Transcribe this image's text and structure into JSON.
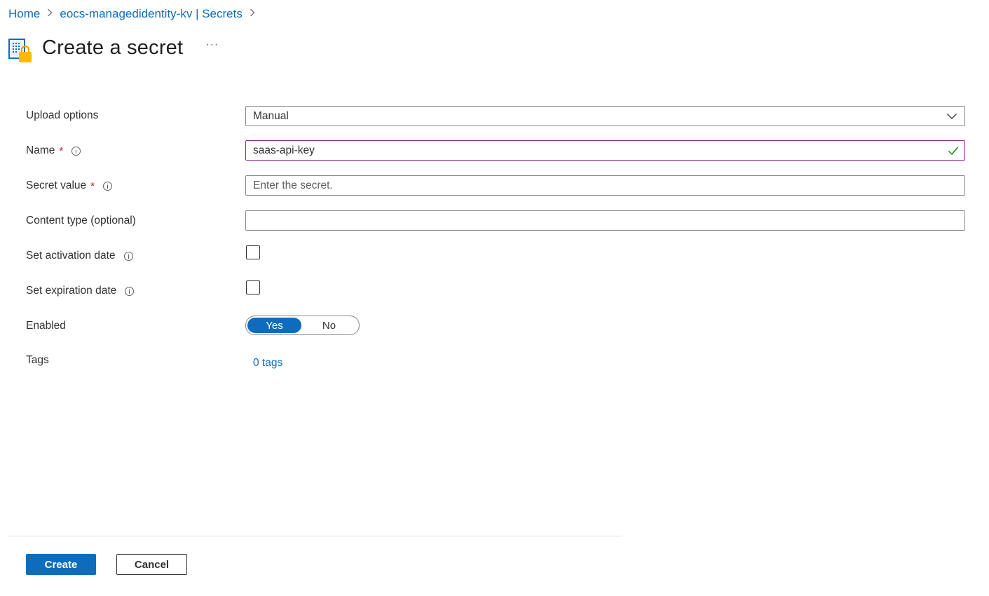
{
  "breadcrumb": {
    "home": "Home",
    "parent": "eocs-managedidentity-kv | Secrets"
  },
  "page": {
    "title": "Create a secret",
    "more": "···"
  },
  "form": {
    "upload_options": {
      "label": "Upload options",
      "value": "Manual"
    },
    "name": {
      "label": "Name",
      "required_mark": "*",
      "value": "saas-api-key"
    },
    "secret_value": {
      "label": "Secret value",
      "required_mark": "*",
      "placeholder": "Enter the secret."
    },
    "content_type": {
      "label": "Content type (optional)",
      "value": ""
    },
    "activation_date": {
      "label": "Set activation date",
      "checked": false
    },
    "expiration_date": {
      "label": "Set expiration date",
      "checked": false
    },
    "enabled": {
      "label": "Enabled",
      "yes": "Yes",
      "no": "No",
      "selected": "Yes"
    },
    "tags": {
      "label": "Tags",
      "link": "0 tags"
    }
  },
  "footer": {
    "create": "Create",
    "cancel": "Cancel"
  },
  "colors": {
    "accent": "#0f6cbd",
    "required": "#a4262c",
    "focus_border": "#8c2a8c",
    "valid_check": "#107c10",
    "lock": "#ffb900"
  }
}
